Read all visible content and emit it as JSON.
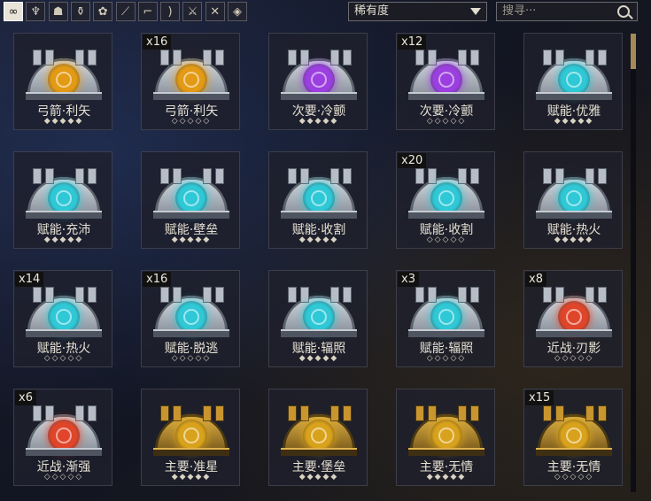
{
  "filter_tabs": [
    {
      "icon": "infinity-icon",
      "glyph": "∞",
      "active": true
    },
    {
      "icon": "wings-icon",
      "glyph": "♆",
      "active": false
    },
    {
      "icon": "bust-icon",
      "glyph": "☗",
      "active": false
    },
    {
      "icon": "urn-icon",
      "glyph": "⚱",
      "active": false
    },
    {
      "icon": "lotus-icon",
      "glyph": "✿",
      "active": false
    },
    {
      "icon": "rifle-icon",
      "glyph": "⟋",
      "active": false
    },
    {
      "icon": "pistol-icon",
      "glyph": "⌐",
      "active": false
    },
    {
      "icon": "bow-icon",
      "glyph": ")",
      "active": false
    },
    {
      "icon": "sword-icon",
      "glyph": "⚔",
      "active": false
    },
    {
      "icon": "crossed-blades-icon",
      "glyph": "✕",
      "active": false
    },
    {
      "icon": "companion-icon",
      "glyph": "◈",
      "active": false
    }
  ],
  "sort": {
    "selected": "稀有度"
  },
  "search": {
    "placeholder": "搜寻···"
  },
  "colors": {
    "orange": "#e39a14",
    "purple": "#9b3fe0",
    "cyan": "#2ec8d6",
    "red": "#e0452a",
    "gold": "#d9a21c"
  },
  "cards": [
    {
      "count": "",
      "name": "弓箭·利矢",
      "stars": "◆◆◆◆◆",
      "gem": "orange",
      "frame": "silver"
    },
    {
      "count": "x16",
      "name": "弓箭·利矢",
      "stars": "◇◇◇◇◇",
      "gem": "orange",
      "frame": "silver"
    },
    {
      "count": "",
      "name": "次要·冷颤",
      "stars": "◆◆◆◆◆",
      "gem": "purple",
      "frame": "silver"
    },
    {
      "count": "x12",
      "name": "次要·冷颤",
      "stars": "◇◇◇◇◇",
      "gem": "purple",
      "frame": "silver"
    },
    {
      "count": "",
      "name": "赋能·优雅",
      "stars": "◆◆◆◆◆",
      "gem": "cyan",
      "frame": "silver"
    },
    {
      "count": "",
      "name": "赋能·充沛",
      "stars": "◆◆◆◆◆",
      "gem": "cyan",
      "frame": "silver"
    },
    {
      "count": "",
      "name": "赋能·壁垒",
      "stars": "◆◆◆◆◆",
      "gem": "cyan",
      "frame": "silver"
    },
    {
      "count": "",
      "name": "赋能·收割",
      "stars": "◆◆◆◆◆",
      "gem": "cyan",
      "frame": "silver"
    },
    {
      "count": "x20",
      "name": "赋能·收割",
      "stars": "◇◇◇◇◇",
      "gem": "cyan",
      "frame": "silver"
    },
    {
      "count": "",
      "name": "赋能·热火",
      "stars": "◆◆◆◆◆",
      "gem": "cyan",
      "frame": "silver"
    },
    {
      "count": "x14",
      "name": "赋能·热火",
      "stars": "◇◇◇◇◇",
      "gem": "cyan",
      "frame": "silver"
    },
    {
      "count": "x16",
      "name": "赋能·脱逃",
      "stars": "◇◇◇◇◇",
      "gem": "cyan",
      "frame": "silver"
    },
    {
      "count": "",
      "name": "赋能·辐照",
      "stars": "◆◆◆◆◆",
      "gem": "cyan",
      "frame": "silver"
    },
    {
      "count": "x3",
      "name": "赋能·辐照",
      "stars": "◇◇◇◇◇",
      "gem": "cyan",
      "frame": "silver"
    },
    {
      "count": "x8",
      "name": "近战·刃影",
      "stars": "◇◇◇◇◇",
      "gem": "red",
      "frame": "silver"
    },
    {
      "count": "x6",
      "name": "近战·渐强",
      "stars": "◇◇◇◇◇",
      "gem": "red",
      "frame": "silver"
    },
    {
      "count": "",
      "name": "主要·准星",
      "stars": "◆◆◆◆◆",
      "gem": "gold",
      "frame": "gold"
    },
    {
      "count": "",
      "name": "主要·堡垒",
      "stars": "◆◆◆◆◆",
      "gem": "gold",
      "frame": "gold"
    },
    {
      "count": "",
      "name": "主要·无情",
      "stars": "◆◆◆◆◆",
      "gem": "gold",
      "frame": "gold"
    },
    {
      "count": "x15",
      "name": "主要·无情",
      "stars": "◇◇◇◇◇",
      "gem": "gold",
      "frame": "gold"
    }
  ]
}
